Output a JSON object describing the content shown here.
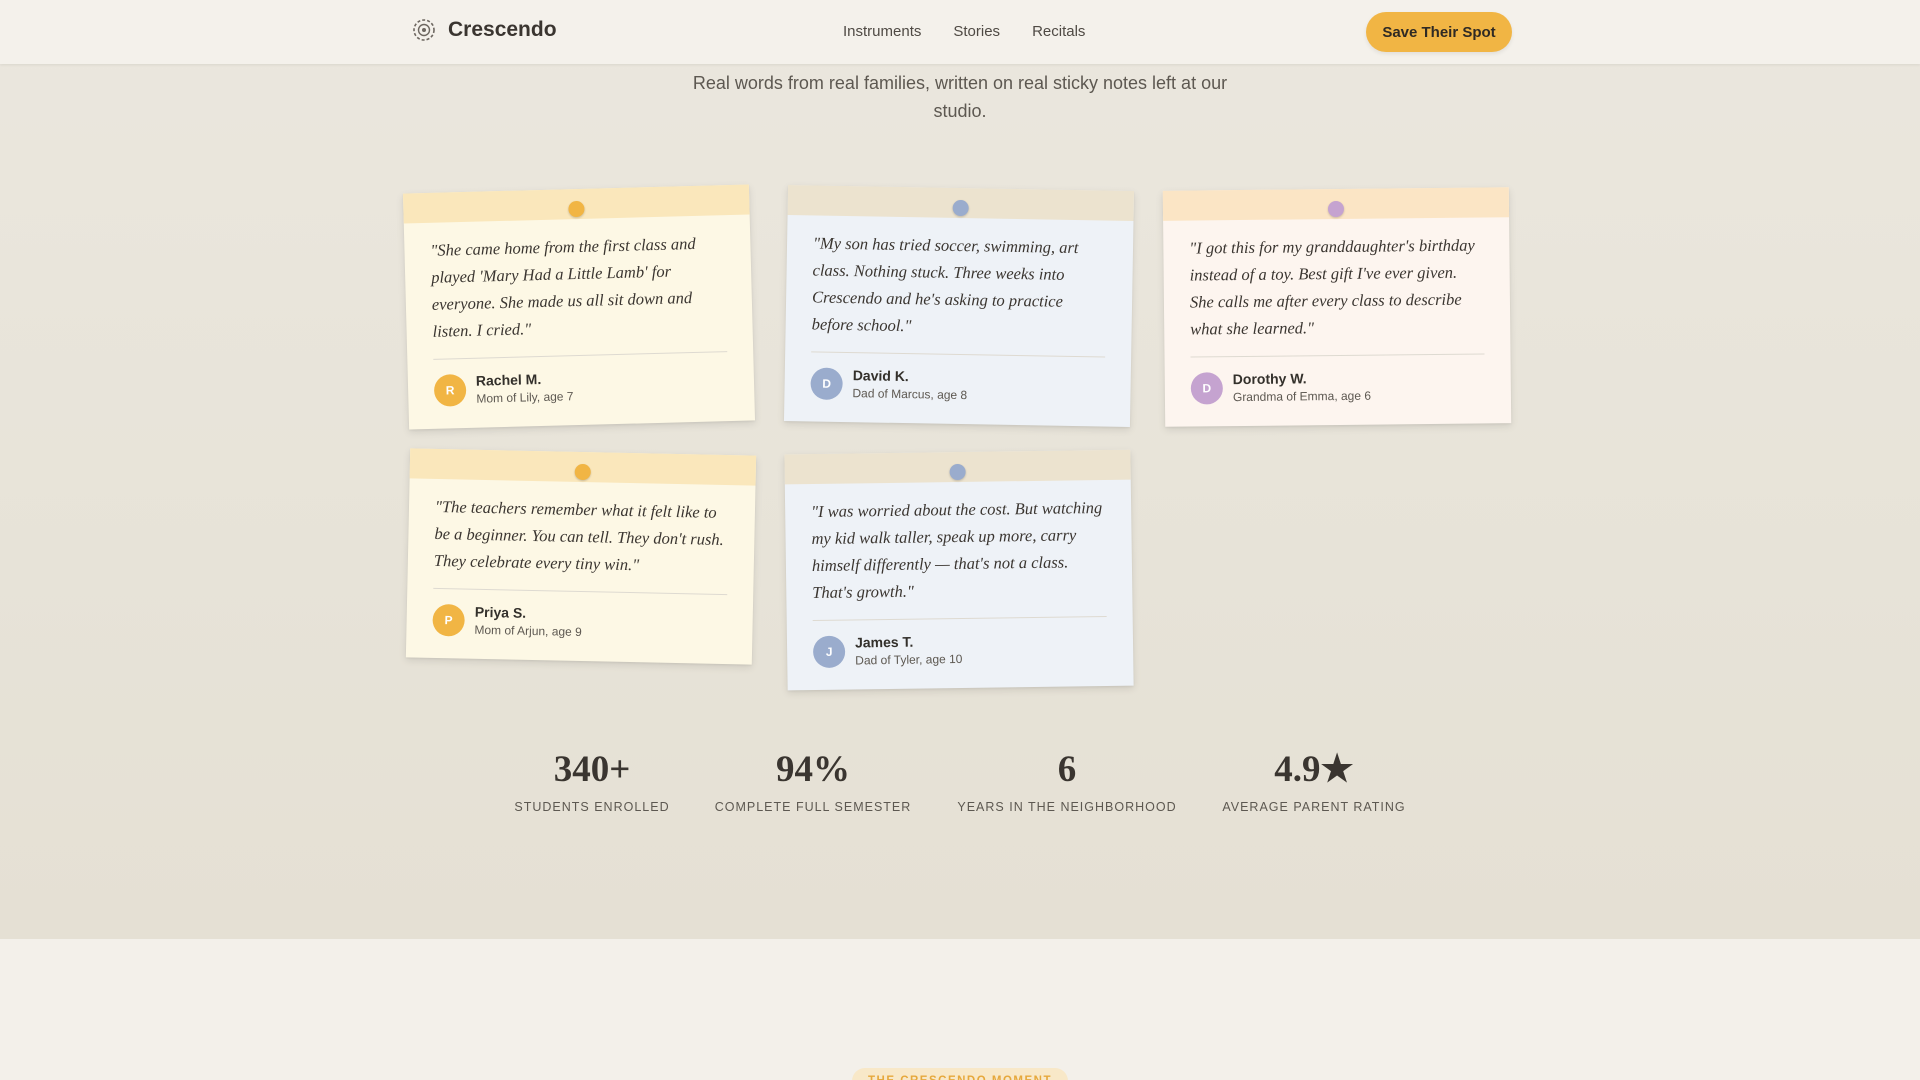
{
  "nav": {
    "brand": "Crescendo",
    "brand_icon": "gear-icon",
    "links": [
      "Instruments",
      "Stories",
      "Recitals"
    ],
    "cta": "Save Their Spot",
    "accent_color": "#f1b544"
  },
  "intro": {
    "subtitle": "Real words from real families, written on real sticky notes left at our studio."
  },
  "testimonials": [
    {
      "quote": "\"She came home from the first class and played 'Mary Had a Little Lamb' for everyone. She made us all sit down and listen. I cried.\"",
      "initial": "R",
      "name": "Rachel M.",
      "relation": "Mom of Lily, age 7",
      "color": "#fdf8e5"
    },
    {
      "quote": "\"My son has tried soccer, swimming, art class. Nothing stuck. Three weeks into Crescendo and he's asking to practice before school.\"",
      "initial": "D",
      "name": "David K.",
      "relation": "Dad of Marcus, age 8",
      "color": "#eef2f7"
    },
    {
      "quote": "\"I got this for my granddaughter's birthday instead of a toy. Best gift I've ever given. She calls me after every class to describe what she learned.\"",
      "initial": "D",
      "name": "Dorothy W.",
      "relation": "Grandma of Emma, age 6",
      "color": "#fdf5ef"
    },
    {
      "quote": "\"The teachers remember what it felt like to be a beginner. You can tell. They don't rush. They celebrate every tiny win.\"",
      "initial": "P",
      "name": "Priya S.",
      "relation": "Mom of Arjun, age 9",
      "color": "#fdf8e5"
    },
    {
      "quote": "\"I was worried about the cost. But watching my kid walk taller, speak up more, carry himself differently — that's not a class. That's growth.\"",
      "initial": "J",
      "name": "James T.",
      "relation": "Dad of Tyler, age 10",
      "color": "#eef2f7"
    }
  ],
  "stats": [
    {
      "value": "340+",
      "label": "STUDENTS ENROLLED"
    },
    {
      "value": "94%",
      "label": "COMPLETE FULL SEMESTER"
    },
    {
      "value": "6",
      "label": "YEARS IN THE NEIGHBORHOOD"
    },
    {
      "value": "4.9★",
      "label": "AVERAGE PARENT RATING"
    }
  ],
  "next_section": {
    "eyebrow": "THE CRESCENDO MOMENT"
  }
}
